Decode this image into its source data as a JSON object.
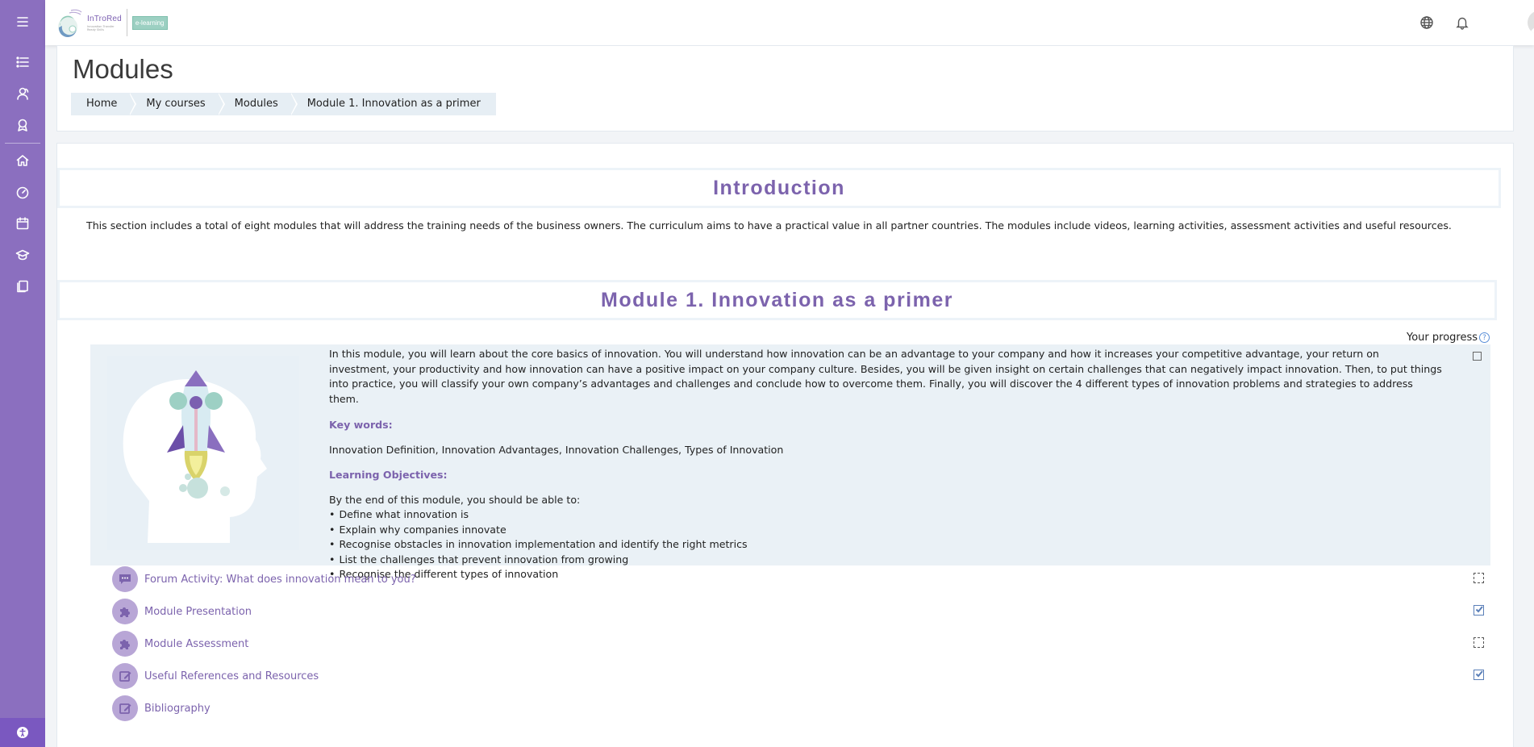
{
  "header": {
    "logo_name": "InTroRed",
    "logo_tagline": "Innovation Transfer Ready Skills",
    "logo_badge": "e-learning"
  },
  "page": {
    "title": "Modules"
  },
  "breadcrumb": [
    "Home",
    "My courses",
    "Modules",
    "Module 1. Innovation as a primer"
  ],
  "intro": {
    "title": "Introduction",
    "text": "This section includes a total of eight modules that will address the training needs of the business owners. The curriculum aims to have a practical value in all partner countries. The modules include videos, learning activities, assessment activities and useful resources."
  },
  "module": {
    "title": "Module 1. Innovation as a primer",
    "progress_label": "Your progress",
    "progress_help": "?",
    "summary": "In this module, you will learn about the core basics of innovation. You will understand how innovation can be an advantage to your company and how it increases your competitive advantage, your return on investment, your productivity and how innovation can have a positive impact on your company culture. Besides, you will be given insight on certain challenges that can negatively impact innovation. Then, to put things into practice, you will classify your own company’s advantages and challenges and conclude how to overcome them. Finally, you will discover the 4 different types of innovation problems and strategies to address them.",
    "keywords_heading": "Key words:",
    "keywords": "Innovation Definition, Innovation Advantages, Innovation Challenges, Types of Innovation",
    "objectives_heading": "Learning Objectives:",
    "objectives_intro": "By the end of this module, you should be able to:",
    "objectives": [
      "Define what innovation is",
      "Explain why companies innovate",
      "Recognise obstacles in innovation implementation and identify the right metrics",
      "List the challenges that prevent innovation from growing",
      "Recognise the different types of innovation"
    ],
    "activities": [
      {
        "label": "Forum Activity: What does innovation mean to you?",
        "icon": "forum-icon",
        "status": "todo"
      },
      {
        "label": "Module Presentation",
        "icon": "puzzle-icon",
        "status": "done"
      },
      {
        "label": "Module Assessment",
        "icon": "puzzle-icon",
        "status": "todo"
      },
      {
        "label": "Useful References and Resources",
        "icon": "edit-page-icon",
        "status": "done"
      },
      {
        "label": "Bibliography",
        "icon": "edit-page-icon",
        "status": "none"
      }
    ]
  },
  "colors": {
    "sidebar": "#8b6fbf",
    "accent": "#7c63ad",
    "summary_bg": "#eaf1f6"
  }
}
